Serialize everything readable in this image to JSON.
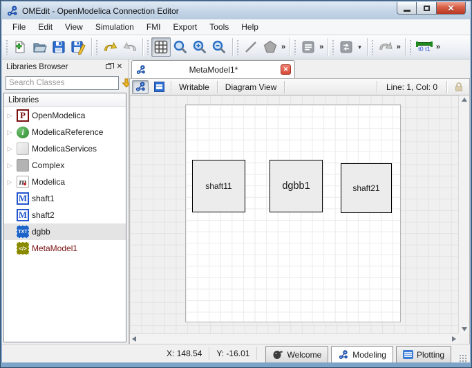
{
  "window": {
    "title": "OMEdit - OpenModelica Connection Editor"
  },
  "icons": {
    "expand_arrow": "▷",
    "overflow_chevron": "»",
    "dropdown_arrow": "▾",
    "close_x": "✕"
  },
  "menu": {
    "items": [
      {
        "label": "File"
      },
      {
        "label": "Edit"
      },
      {
        "label": "View"
      },
      {
        "label": "Simulation"
      },
      {
        "label": "FMI"
      },
      {
        "label": "Export"
      },
      {
        "label": "Tools"
      },
      {
        "label": "Help"
      }
    ]
  },
  "toolbar": {
    "sim_time_t0": "t0",
    "sim_time_t1": "t1"
  },
  "libraries": {
    "title": "Libraries Browser",
    "search_placeholder": "Search Classes",
    "header": "Libraries",
    "items": [
      {
        "label": "OpenModelica",
        "glyph": "P"
      },
      {
        "label": "ModelicaReference",
        "glyph": "i"
      },
      {
        "label": "ModelicaServices",
        "glyph": ""
      },
      {
        "label": "Complex",
        "glyph": ""
      },
      {
        "label": "Modelica",
        "glyph": "m"
      },
      {
        "label": "shaft1",
        "glyph": "M"
      },
      {
        "label": "shaft2",
        "glyph": "M"
      },
      {
        "label": "dgbb",
        "glyph": "TXT"
      },
      {
        "label": "MetaModel1",
        "glyph": "</>"
      }
    ]
  },
  "document": {
    "tab_label": "MetaModel1*",
    "writable": "Writable",
    "view_mode": "Diagram View",
    "line_col": "Line: 1, Col: 0",
    "components": [
      {
        "name": "shaft11"
      },
      {
        "name": "dgbb1"
      },
      {
        "name": "shaft21"
      }
    ]
  },
  "statusbar": {
    "x": "X: 148.54",
    "y": "Y: -16.01",
    "perspectives": [
      {
        "label": "Welcome"
      },
      {
        "label": "Modeling"
      },
      {
        "label": "Plotting"
      }
    ]
  },
  "colors": {
    "accent_blue": "#2255cc",
    "close_red": "#d64937",
    "metamodel_text": "#7a1010",
    "sim_time_green": "#1f8a1f",
    "canvas_white": "#ffffff",
    "component_fill": "#ececec"
  }
}
